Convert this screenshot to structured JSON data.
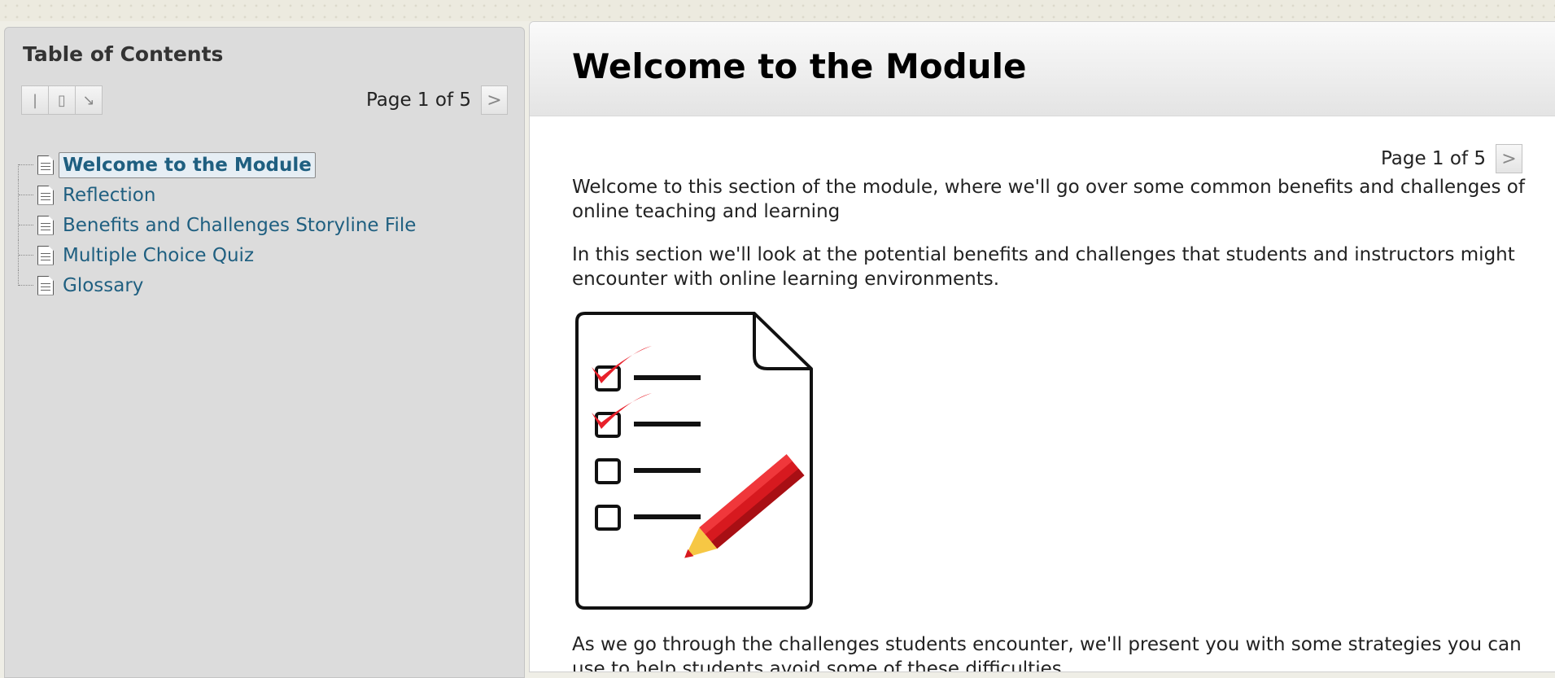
{
  "sidebar": {
    "title": "Table of Contents",
    "tools": [
      {
        "icon": "collapse-all-icon",
        "glyph": "|"
      },
      {
        "icon": "expand-all-icon",
        "glyph": "▯"
      },
      {
        "icon": "detach-icon",
        "glyph": "↘"
      }
    ],
    "pager_text": "Page 1 of 5",
    "next_glyph": ">",
    "items": [
      {
        "label": "Welcome to the Module",
        "active": true
      },
      {
        "label": "Reflection",
        "active": false
      },
      {
        "label": "Benefits and Challenges Storyline File",
        "active": false
      },
      {
        "label": "Multiple Choice Quiz",
        "active": false
      },
      {
        "label": "Glossary",
        "active": false
      }
    ]
  },
  "content": {
    "title": "Welcome to the Module",
    "pager_text": "Page 1 of 5",
    "next_glyph": ">",
    "paragraphs": [
      "Welcome to this section of the module, where we'll go over some common benefits and challenges of online teaching and learning",
      "In this section we'll look at the potential benefits and challenges that students and instructors might encounter with online learning environments.",
      "As we go through the challenges students encounter, we'll present you with some strategies you can use to help students avoid some of these difficulties."
    ],
    "illustration": {
      "icon": "checklist-with-pencil-icon",
      "checked_items": 2,
      "total_items": 4
    }
  },
  "colors": {
    "link": "#1f5f80",
    "sidebar_bg": "#dcdcdc",
    "check_red": "#e8202a",
    "pencil_red": "#d7191f",
    "pencil_tip": "#f6c744"
  }
}
